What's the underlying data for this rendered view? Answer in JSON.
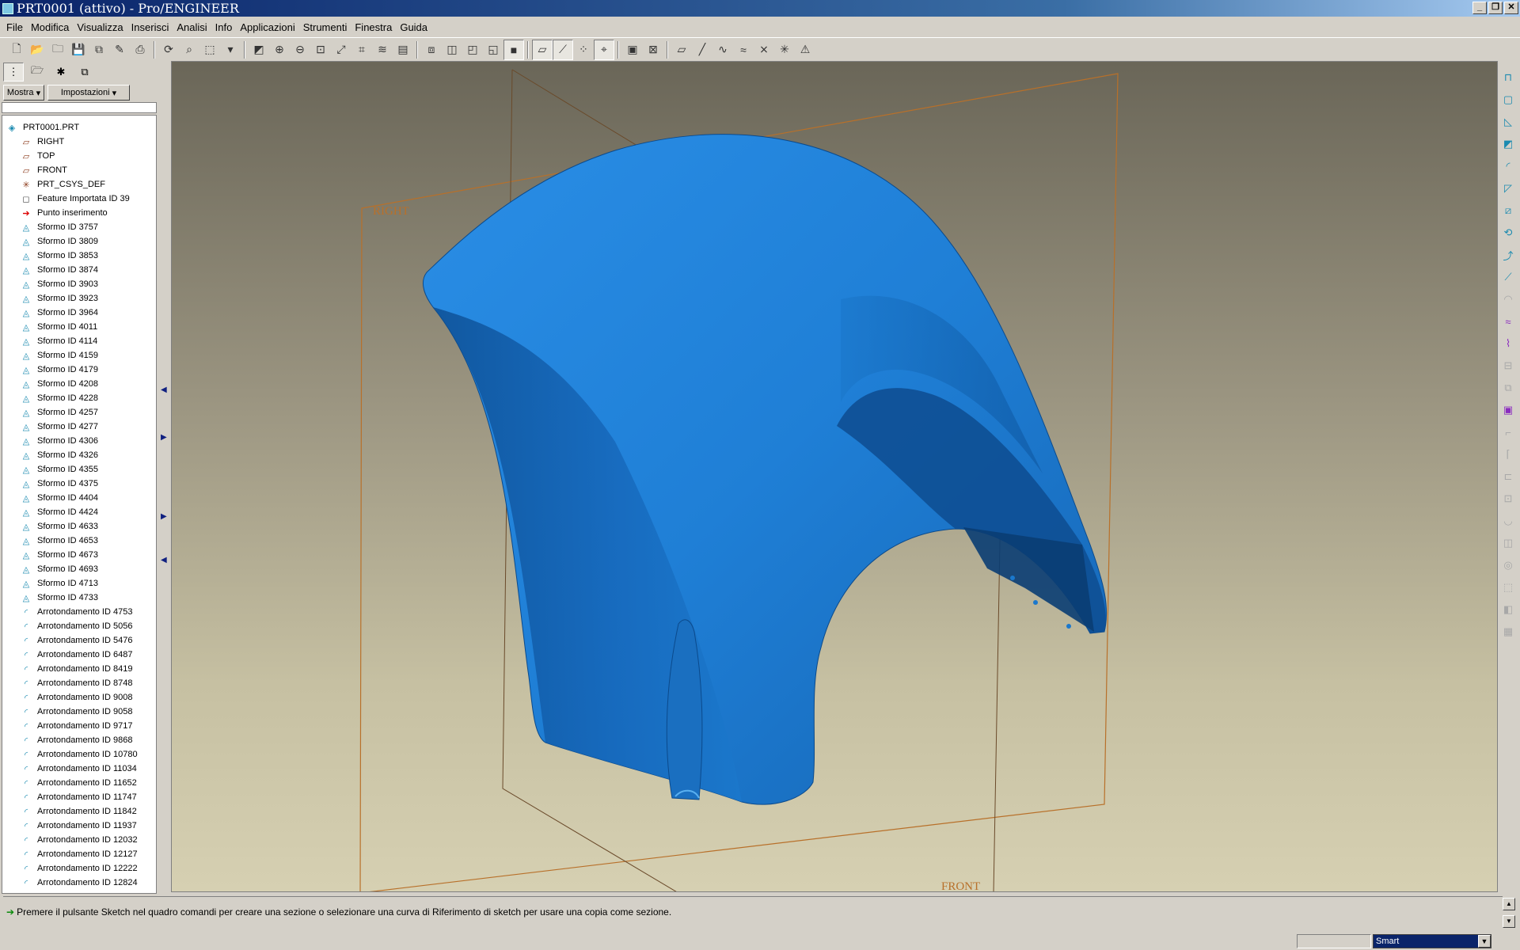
{
  "window": {
    "title": "PRT0001 (attivo) - Pro/ENGINEER"
  },
  "menu": [
    "File",
    "Modifica",
    "Visualizza",
    "Inserisci",
    "Analisi",
    "Info",
    "Applicazioni",
    "Strumenti",
    "Finestra",
    "Guida"
  ],
  "toolbar": {
    "groups": [
      [
        {
          "name": "new-file-icon",
          "glyph": "🗋"
        },
        {
          "name": "open-file-icon",
          "glyph": "📂"
        },
        {
          "name": "open-session-icon",
          "glyph": "🗀"
        },
        {
          "name": "save-icon",
          "glyph": "💾"
        },
        {
          "name": "save-copy-icon",
          "glyph": "⧉"
        },
        {
          "name": "edit-icon",
          "glyph": "✎"
        },
        {
          "name": "print-icon",
          "glyph": "⎙"
        }
      ],
      [
        {
          "name": "regenerate-icon",
          "glyph": "⟳"
        },
        {
          "name": "find-icon",
          "glyph": "⌕"
        },
        {
          "name": "select-box-icon",
          "glyph": "⬚"
        },
        {
          "name": "dropdown-icon",
          "glyph": "▾"
        }
      ],
      [
        {
          "name": "repaint-icon",
          "glyph": "◩"
        },
        {
          "name": "zoom-in-icon",
          "glyph": "⊕"
        },
        {
          "name": "zoom-out-icon",
          "glyph": "⊖"
        },
        {
          "name": "zoom-fit-icon",
          "glyph": "⊡"
        },
        {
          "name": "orient-icon",
          "glyph": "⤢"
        },
        {
          "name": "view-manager-icon",
          "glyph": "⌗"
        },
        {
          "name": "layers-icon",
          "glyph": "≋"
        },
        {
          "name": "saved-views-icon",
          "glyph": "▤"
        }
      ],
      [
        {
          "name": "wireframe-icon",
          "glyph": "⧈"
        },
        {
          "name": "hidden-line-icon",
          "glyph": "◫"
        },
        {
          "name": "no-hidden-icon",
          "glyph": "◰"
        },
        {
          "name": "shaded-icon",
          "glyph": "◱"
        },
        {
          "name": "shaded-edges-icon",
          "glyph": "■",
          "pressed": true
        }
      ],
      [
        {
          "name": "datum-planes-display-icon",
          "glyph": "▱",
          "pressed": true
        },
        {
          "name": "datum-axes-display-icon",
          "glyph": "⟋",
          "pressed": true
        },
        {
          "name": "datum-points-display-icon",
          "glyph": "⁘",
          "pressed": false
        },
        {
          "name": "csys-display-icon",
          "glyph": "⌖",
          "pressed": true
        }
      ],
      [
        {
          "name": "model-tree-window-icon",
          "glyph": "▣"
        },
        {
          "name": "close-window-icon",
          "glyph": "⊠"
        }
      ],
      [
        {
          "name": "datum-plane-tool-icon",
          "glyph": "▱"
        },
        {
          "name": "datum-axis-tool-icon",
          "glyph": "╱"
        },
        {
          "name": "datum-curve-tool-icon",
          "glyph": "∿"
        },
        {
          "name": "sketched-curve-tool-icon",
          "glyph": "≈"
        },
        {
          "name": "datum-point-tool-icon",
          "glyph": "⨯"
        },
        {
          "name": "csys-tool-icon",
          "glyph": "✳"
        },
        {
          "name": "analysis-feature-icon",
          "glyph": "⚠"
        }
      ]
    ]
  },
  "left_panel": {
    "tabs": [
      {
        "name": "model-tree-tab-icon",
        "glyph": "⋮"
      },
      {
        "name": "folder-browser-tab-icon",
        "glyph": "🗁"
      },
      {
        "name": "favorites-tab-icon",
        "glyph": "✱"
      },
      {
        "name": "connections-tab-icon",
        "glyph": "⧉"
      }
    ],
    "show_button": "Mostra",
    "settings_button": "Impostazioni"
  },
  "model_tree": [
    {
      "label": "PRT0001.PRT",
      "type": "part"
    },
    {
      "label": "RIGHT",
      "type": "plane"
    },
    {
      "label": "TOP",
      "type": "plane"
    },
    {
      "label": "FRONT",
      "type": "plane"
    },
    {
      "label": "PRT_CSYS_DEF",
      "type": "csys"
    },
    {
      "label": "Feature Importata ID 39",
      "type": "import"
    },
    {
      "label": "Punto inserimento",
      "type": "insert"
    },
    {
      "label": "Sformo ID 3757",
      "type": "draft"
    },
    {
      "label": "Sformo ID 3809",
      "type": "draft"
    },
    {
      "label": "Sformo ID 3853",
      "type": "draft"
    },
    {
      "label": "Sformo ID 3874",
      "type": "draft"
    },
    {
      "label": "Sformo ID 3903",
      "type": "draft"
    },
    {
      "label": "Sformo ID 3923",
      "type": "draft"
    },
    {
      "label": "Sformo ID 3964",
      "type": "draft"
    },
    {
      "label": "Sformo ID 4011",
      "type": "draft"
    },
    {
      "label": "Sformo ID 4114",
      "type": "draft"
    },
    {
      "label": "Sformo ID 4159",
      "type": "draft"
    },
    {
      "label": "Sformo ID 4179",
      "type": "draft"
    },
    {
      "label": "Sformo ID 4208",
      "type": "draft"
    },
    {
      "label": "Sformo ID 4228",
      "type": "draft"
    },
    {
      "label": "Sformo ID 4257",
      "type": "draft"
    },
    {
      "label": "Sformo ID 4277",
      "type": "draft"
    },
    {
      "label": "Sformo ID 4306",
      "type": "draft"
    },
    {
      "label": "Sformo ID 4326",
      "type": "draft"
    },
    {
      "label": "Sformo ID 4355",
      "type": "draft"
    },
    {
      "label": "Sformo ID 4375",
      "type": "draft"
    },
    {
      "label": "Sformo ID 4404",
      "type": "draft"
    },
    {
      "label": "Sformo ID 4424",
      "type": "draft"
    },
    {
      "label": "Sformo ID 4633",
      "type": "draft"
    },
    {
      "label": "Sformo ID 4653",
      "type": "draft"
    },
    {
      "label": "Sformo ID 4673",
      "type": "draft"
    },
    {
      "label": "Sformo ID 4693",
      "type": "draft"
    },
    {
      "label": "Sformo ID 4713",
      "type": "draft"
    },
    {
      "label": "Sformo ID 4733",
      "type": "draft"
    },
    {
      "label": "Arrotondamento ID 4753",
      "type": "round"
    },
    {
      "label": "Arrotondamento ID 5056",
      "type": "round"
    },
    {
      "label": "Arrotondamento ID 5476",
      "type": "round"
    },
    {
      "label": "Arrotondamento ID 6487",
      "type": "round"
    },
    {
      "label": "Arrotondamento ID 8419",
      "type": "round"
    },
    {
      "label": "Arrotondamento ID 8748",
      "type": "round"
    },
    {
      "label": "Arrotondamento ID 9008",
      "type": "round"
    },
    {
      "label": "Arrotondamento ID 9058",
      "type": "round"
    },
    {
      "label": "Arrotondamento ID 9717",
      "type": "round"
    },
    {
      "label": "Arrotondamento ID 9868",
      "type": "round"
    },
    {
      "label": "Arrotondamento ID 10780",
      "type": "round"
    },
    {
      "label": "Arrotondamento ID 11034",
      "type": "round"
    },
    {
      "label": "Arrotondamento ID 11652",
      "type": "round"
    },
    {
      "label": "Arrotondamento ID 11747",
      "type": "round"
    },
    {
      "label": "Arrotondamento ID 11842",
      "type": "round"
    },
    {
      "label": "Arrotondamento ID 11937",
      "type": "round"
    },
    {
      "label": "Arrotondamento ID 12032",
      "type": "round"
    },
    {
      "label": "Arrotondamento ID 12127",
      "type": "round"
    },
    {
      "label": "Arrotondamento ID 12222",
      "type": "round"
    },
    {
      "label": "Arrotondamento ID 12824",
      "type": "round"
    }
  ],
  "viewport": {
    "datum_labels": {
      "right": "RIGHT",
      "front": "FRONT"
    },
    "colors": {
      "model": "#1f7fd6",
      "model_dark": "#0d4f94",
      "datum": "#b8702a"
    }
  },
  "right_toolbar": [
    {
      "name": "hole-tool-icon",
      "glyph": "⊓",
      "state": "active"
    },
    {
      "name": "shell-tool-icon",
      "glyph": "▢",
      "state": "active"
    },
    {
      "name": "rib-tool-icon",
      "glyph": "◺",
      "state": "active"
    },
    {
      "name": "draft-tool-icon",
      "glyph": "◩",
      "state": "active"
    },
    {
      "name": "round-tool-icon",
      "glyph": "◜",
      "state": "active"
    },
    {
      "name": "chamfer-tool-icon",
      "glyph": "◸",
      "state": "active"
    },
    {
      "name": "extrude-tool-icon",
      "glyph": "⧄",
      "state": "active"
    },
    {
      "name": "revolve-tool-icon",
      "glyph": "⟲",
      "state": "active"
    },
    {
      "name": "sweep-tool-icon",
      "glyph": "⤴",
      "state": "active"
    },
    {
      "name": "blend-tool-icon",
      "glyph": "⟋",
      "state": "active"
    },
    {
      "name": "boundary-tool-icon",
      "glyph": "◠",
      "state": "dim"
    },
    {
      "name": "style-tool-icon",
      "glyph": "≈",
      "state": "purple"
    },
    {
      "name": "variable-sweep-icon",
      "glyph": "⌇",
      "state": "purple"
    },
    {
      "name": "offset-tool-icon",
      "glyph": "⊟",
      "state": "dim"
    },
    {
      "name": "copy-tool-icon",
      "glyph": "⧉",
      "state": "dim"
    },
    {
      "name": "merge-tool-icon",
      "glyph": "▣",
      "state": "purple"
    },
    {
      "name": "trim-tool-icon",
      "glyph": "⌐",
      "state": "dim"
    },
    {
      "name": "extend-tool-icon",
      "glyph": "⌈",
      "state": "dim"
    },
    {
      "name": "thicken-tool-icon",
      "glyph": "⊏",
      "state": "dim"
    },
    {
      "name": "solidify-tool-icon",
      "glyph": "⊡",
      "state": "dim"
    },
    {
      "name": "intersect-tool-icon",
      "glyph": "◡",
      "state": "dim"
    },
    {
      "name": "project-tool-icon",
      "glyph": "◫",
      "state": "dim"
    },
    {
      "name": "wrap-tool-icon",
      "glyph": "◎",
      "state": "dim"
    },
    {
      "name": "pattern-tool-icon",
      "glyph": "⬚",
      "state": "dim"
    },
    {
      "name": "mirror-tool-icon",
      "glyph": "◧",
      "state": "dim"
    },
    {
      "name": "grid-tool-icon",
      "glyph": "▦",
      "state": "dim"
    }
  ],
  "message": "Premere il pulsante Sketch nel quadro comandi per creare una sezione o selezionare una curva di Riferimento di sketch per usare una copia come sezione.",
  "status": {
    "filter": "Smart"
  }
}
